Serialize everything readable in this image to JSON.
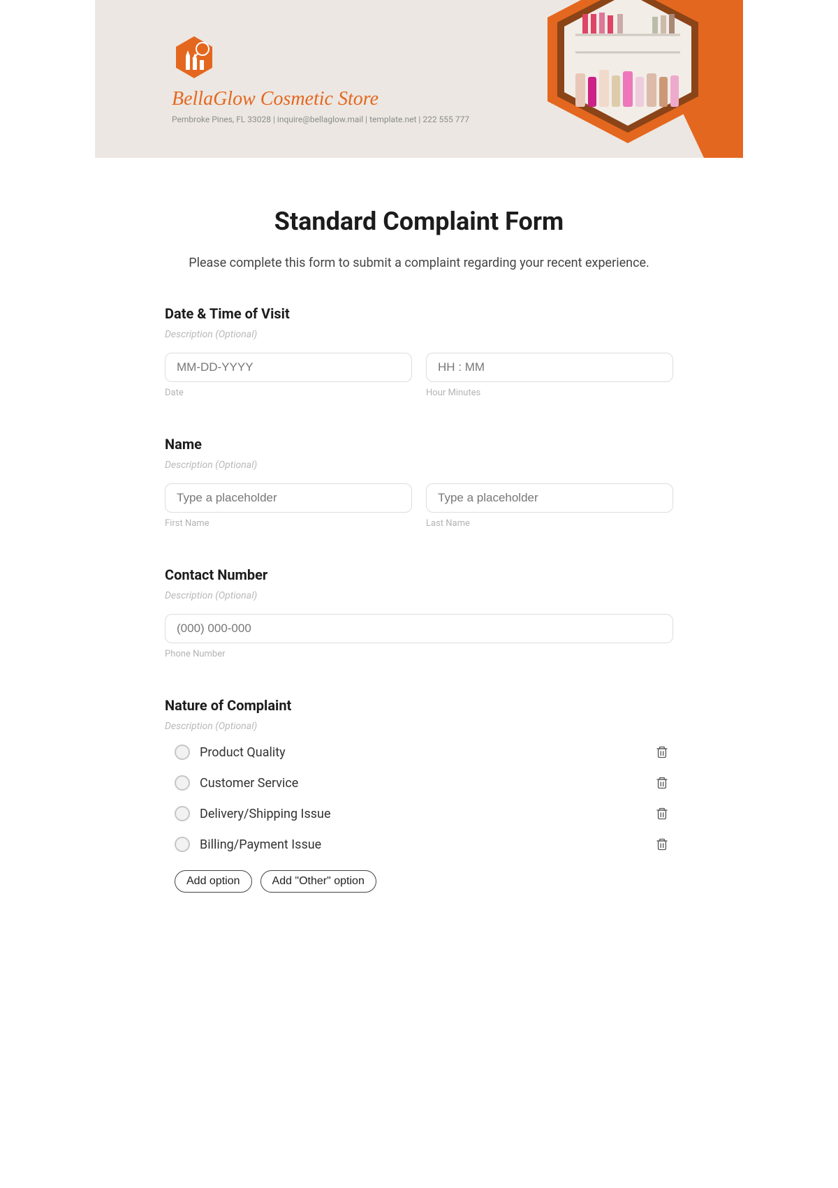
{
  "header": {
    "brand_name": "BellaGlow Cosmetic Store",
    "contact_line": "Pembroke Pines, FL 33028 | inquire@bellaglow.mail | template.net | 222 555 777"
  },
  "form": {
    "title": "Standard Complaint Form",
    "intro": "Please complete this form to submit a complaint regarding your recent experience."
  },
  "sections": {
    "datetime": {
      "title": "Date & Time of Visit",
      "desc": "Description (Optional)",
      "date_placeholder": "MM-DD-YYYY",
      "date_sub": "Date",
      "time_placeholder": "HH : MM",
      "time_sub": "Hour Minutes"
    },
    "name": {
      "title": "Name",
      "desc": "Description (Optional)",
      "first_placeholder": "Type a placeholder",
      "first_sub": "First Name",
      "last_placeholder": "Type a placeholder",
      "last_sub": "Last Name"
    },
    "contact": {
      "title": "Contact Number",
      "desc": "Description (Optional)",
      "phone_placeholder": "(000) 000-000",
      "phone_sub": "Phone Number"
    },
    "nature": {
      "title": "Nature of Complaint",
      "desc": "Description (Optional)",
      "options": [
        "Product Quality",
        "Customer Service",
        "Delivery/Shipping Issue",
        "Billing/Payment Issue"
      ],
      "add_option": "Add option",
      "add_other": "Add \"Other\" option"
    }
  }
}
